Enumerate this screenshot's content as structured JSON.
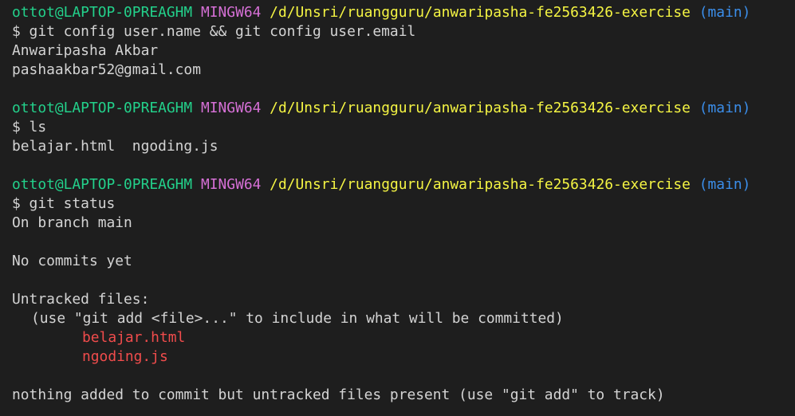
{
  "colors": {
    "background": "#1e1e1e",
    "text": "#d4d4d4",
    "user_host": "#23d18b",
    "msystem": "#d670d6",
    "path": "#f5f543",
    "git_branch": "#3b8eea",
    "untracked_file": "#f14c4c"
  },
  "prompt": {
    "user_host": "ottot@LAPTOP-0PREAGHM",
    "msystem": "MINGW64",
    "path": "/d/Unsri/ruangguru/anwaripasha-fe2563426-exercise",
    "branch": "(main)"
  },
  "blocks": [
    {
      "command": "$ git config user.name && git config user.email",
      "output": [
        "Anwaripasha Akbar",
        "pashaakbar52@gmail.com"
      ]
    },
    {
      "command": "$ ls",
      "output": [
        "belajar.html  ngoding.js"
      ]
    },
    {
      "command": "$ git status",
      "status": {
        "on_branch": "On branch main",
        "no_commits": "No commits yet",
        "untracked_header": "Untracked files:",
        "hint": "(use \"git add <file>...\" to include in what will be committed)",
        "files": [
          "belajar.html",
          "ngoding.js"
        ],
        "summary": "nothing added to commit but untracked files present (use \"git add\" to track)"
      }
    }
  ]
}
